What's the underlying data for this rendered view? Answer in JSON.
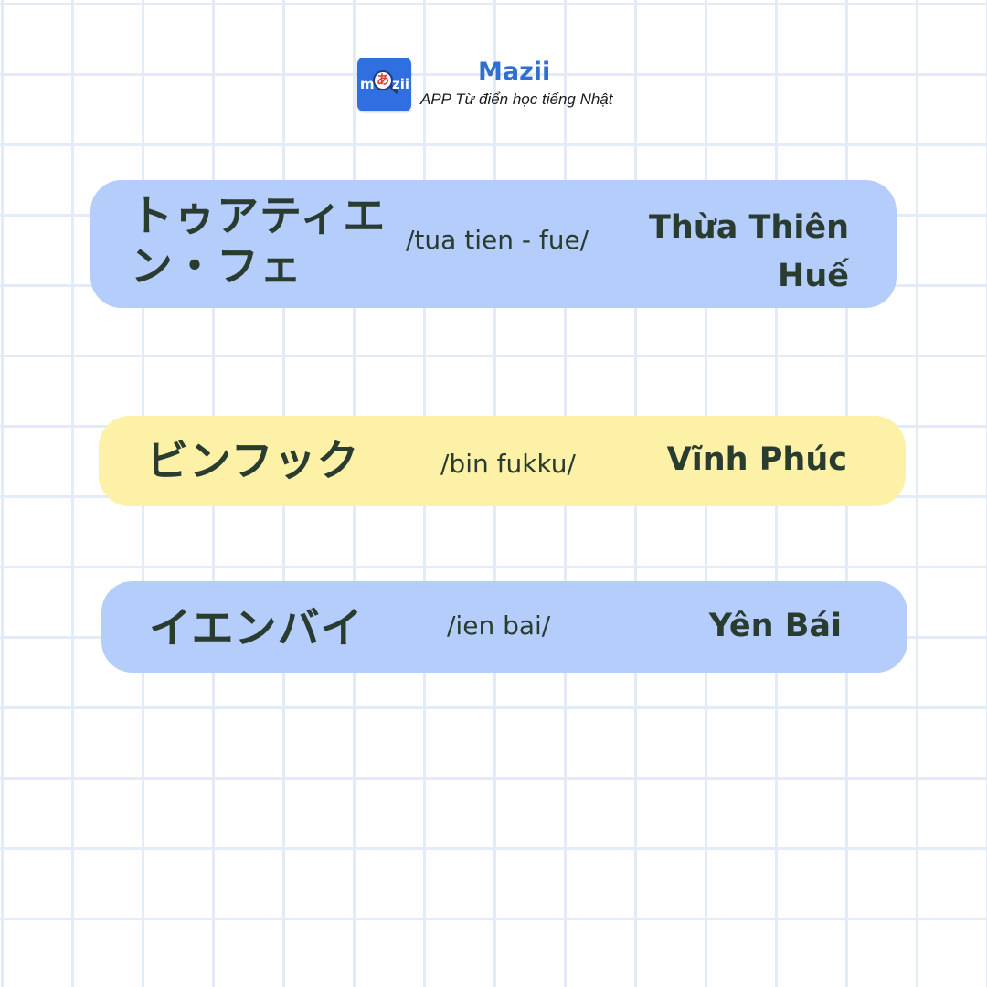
{
  "brand": {
    "logo_left": "m",
    "logo_kana": "あ",
    "logo_right": "zii",
    "name": "Mazii",
    "tagline": "APP Từ điển học tiếng Nhật"
  },
  "colors": {
    "brand_blue": "#2f6fe0",
    "card_blue": "#b5cdfb",
    "card_yellow": "#fcf1a7",
    "text_dark": "#2a3b30",
    "grid_line": "#e3ebf8"
  },
  "cards": [
    {
      "japanese": "トゥアティエン・フェ",
      "romaji": "/tua tien - fue/",
      "vietnamese": "Thừa Thiên Huế"
    },
    {
      "japanese": "ビンフック",
      "romaji": "/bin fukku/",
      "vietnamese": "Vĩnh Phúc"
    },
    {
      "japanese": "イエンバイ",
      "romaji": "/ien bai/",
      "vietnamese": "Yên Bái"
    }
  ]
}
